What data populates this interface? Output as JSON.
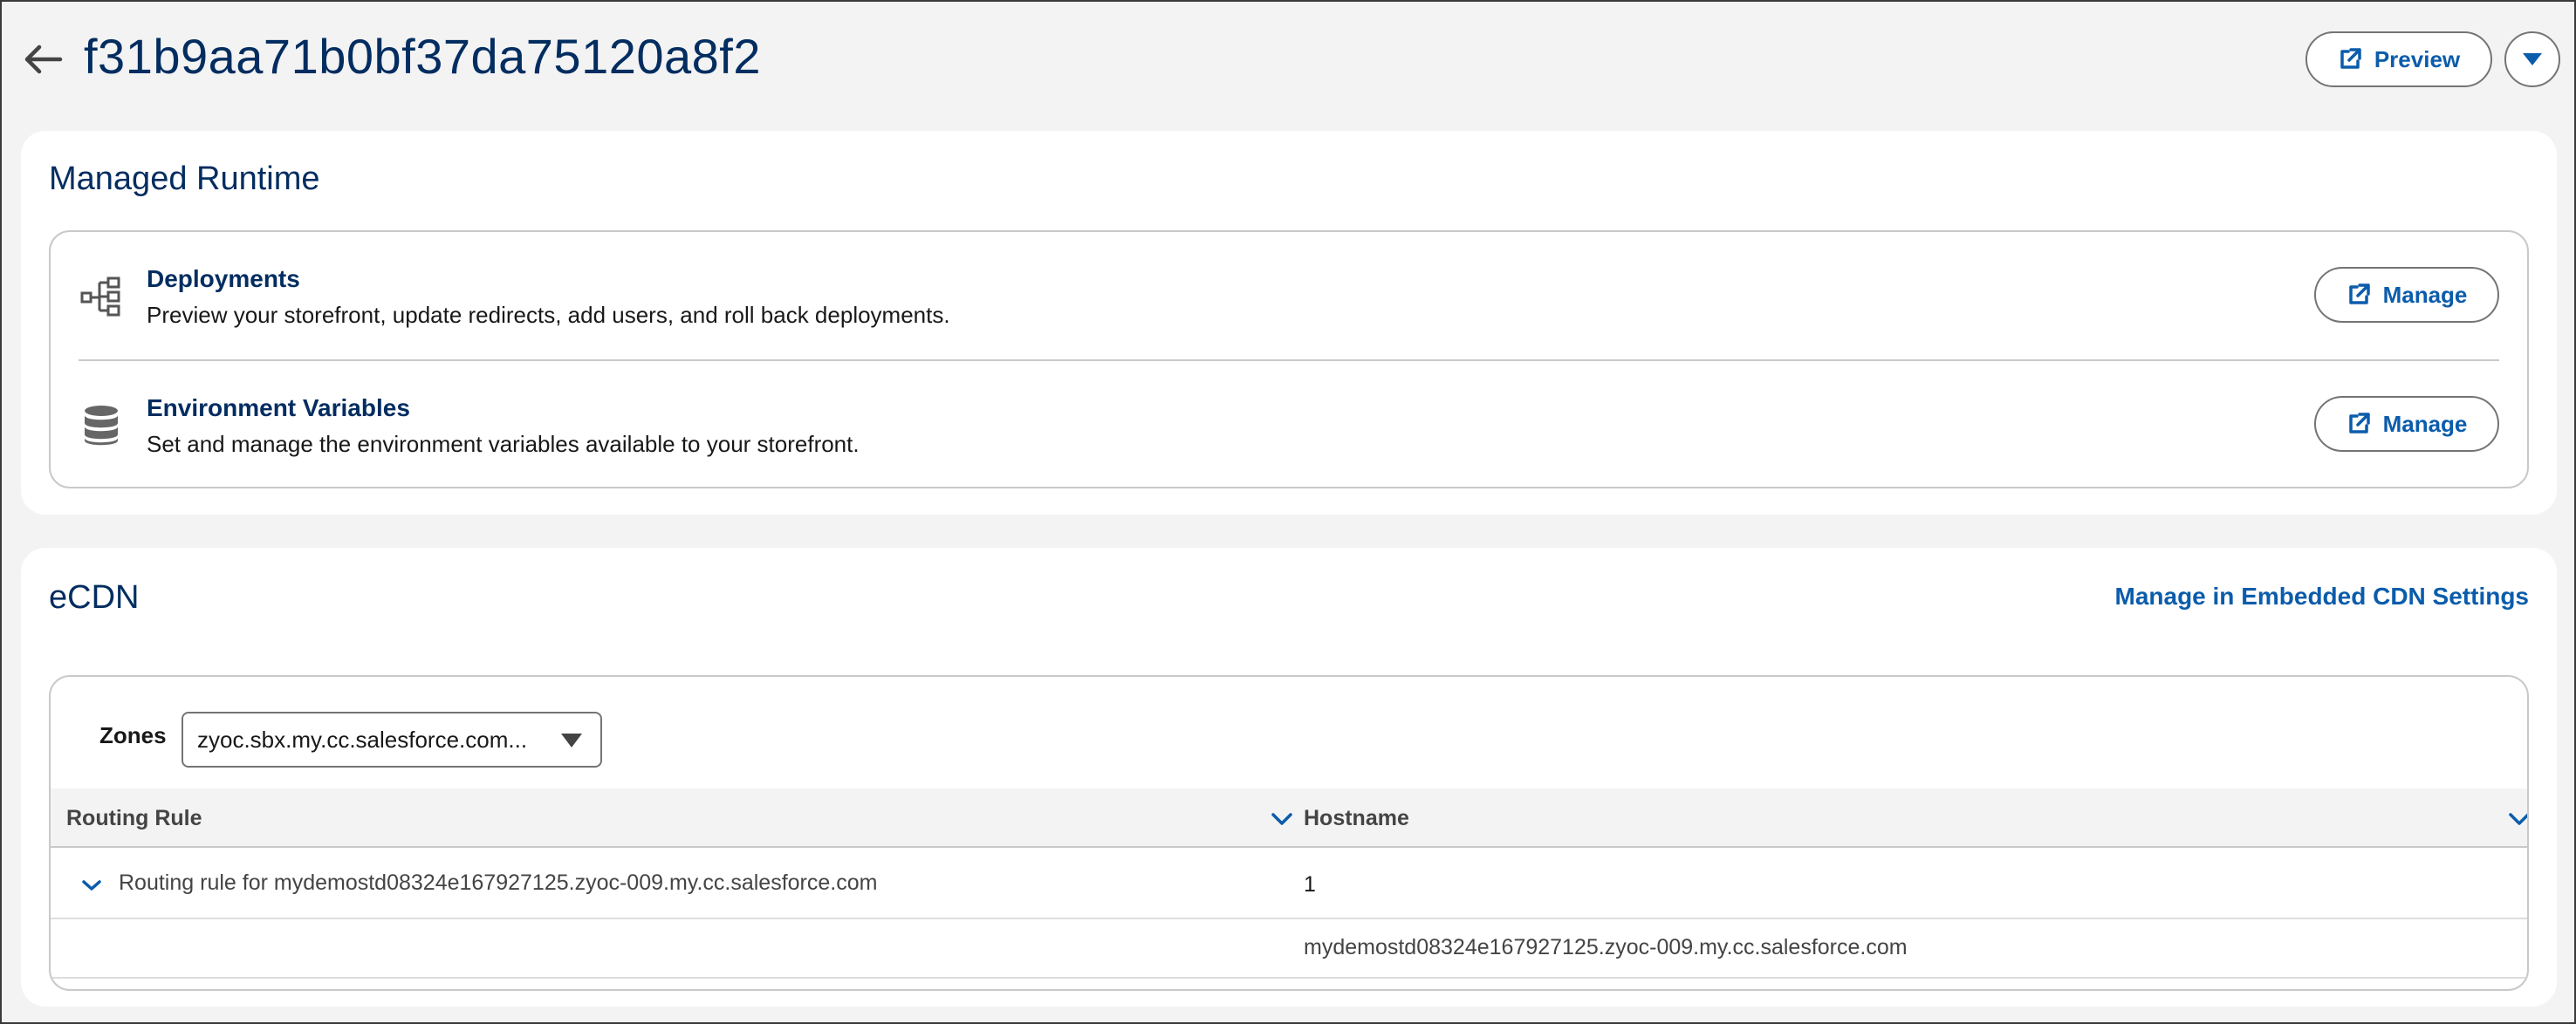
{
  "header": {
    "title": "f31b9aa71b0bf37da75120a8f2",
    "preview_label": "Preview"
  },
  "managed_runtime": {
    "title": "Managed Runtime",
    "items": [
      {
        "title": "Deployments",
        "description": "Preview your storefront, update redirects, add users, and roll back deployments.",
        "button_label": "Manage",
        "icon": "hierarchy-icon"
      },
      {
        "title": "Environment Variables",
        "description": "Set and manage the environment variables available to your storefront.",
        "button_label": "Manage",
        "icon": "database-icon"
      }
    ]
  },
  "ecdn": {
    "title": "eCDN",
    "settings_link": "Manage in Embedded CDN Settings",
    "zones_label": "Zones",
    "zones_selected": "zyoc.sbx.my.cc.salesforce.com...",
    "table": {
      "columns": [
        "Routing Rule",
        "Hostname"
      ],
      "rows": [
        {
          "rule": "Routing rule for mydemostd08324e167927125.zyoc-009.my.cc.salesforce.com",
          "host": "1"
        },
        {
          "rule": "",
          "host": "mydemostd08324e167927125.zyoc-009.my.cc.salesforce.com"
        }
      ]
    }
  },
  "colors": {
    "brand_blue": "#0b5cab",
    "title_navy": "#032d60",
    "page_bg": "#f3f3f3"
  }
}
